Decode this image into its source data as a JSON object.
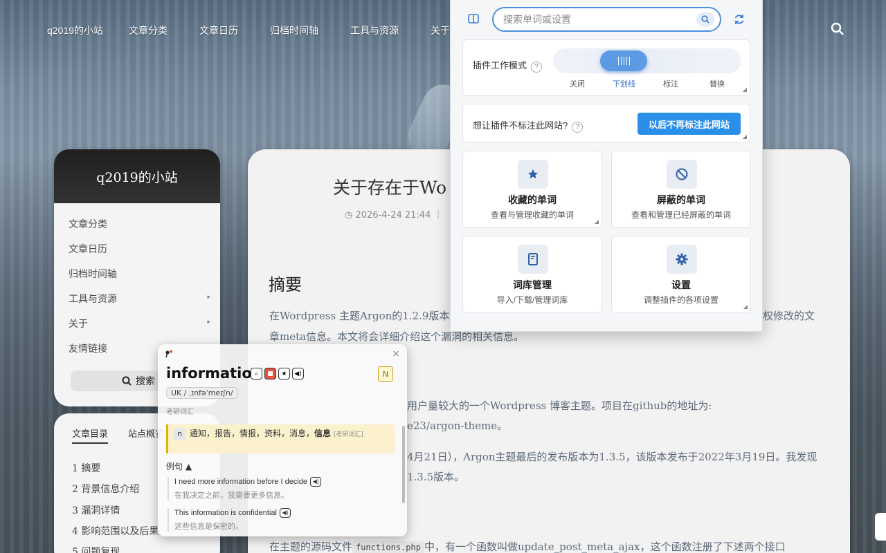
{
  "nav": {
    "brand": "q2019的小站",
    "items": [
      "文章分类",
      "文章日历",
      "归档时间轴",
      "工具与资源",
      "关于"
    ]
  },
  "sidebar": {
    "title": "q2019的小站",
    "items": [
      {
        "label": "文章分类"
      },
      {
        "label": "文章日历"
      },
      {
        "label": "归档时间轴"
      },
      {
        "label": "工具与资源",
        "caret": "▸"
      },
      {
        "label": "关于",
        "caret": "▸"
      },
      {
        "label": "友情链接"
      }
    ],
    "search_label": "搜索"
  },
  "toc": {
    "tabs": [
      "文章目录",
      "站点概览"
    ],
    "items": [
      "1 摘要",
      "2 背景信息介绍",
      "3 漏洞详情",
      "4 影响范围以及后果",
      "5 问题复现"
    ]
  },
  "article": {
    "title_visible": "关于存在于Wo",
    "meta_date": "2026-4-24 21:44",
    "heading": "摘要",
    "p1_a": "在Wordpress 主题Argon的1.2.9版本",
    "p1_b": "权修改的文",
    "p1_c": "章meta信息。本文将会详细介绍这个漏洞的相关信息。",
    "p2_a": "用户量较大的一个Wordpress 博客主题。项目在github的地址为:",
    "p2_b": "e23/argon-theme。",
    "p3_a": "4月21日），Argon主题最后的发布版本为1.3.5，该版本发布于2022年3月19日。我发现",
    "p3_b": "1.3.5版本。",
    "p4_a": "在主题的源码文件",
    "p4_code": "functions.php",
    "p4_b": "中，有一个函数叫做update_post_meta_ajax，这个函数注册了下述两个接口"
  },
  "plugin": {
    "search_placeholder": "搜索单词或设置",
    "mode_label": "插件工作模式",
    "mode_help": "?",
    "mode_options": [
      "关闭",
      "下划线",
      "标注",
      "替换"
    ],
    "mode_selected": "下划线",
    "site_label": "想让插件不标注此网站?",
    "site_button": "以后不再标注此网站",
    "tiles": [
      {
        "title": "收藏的单词",
        "sub": "查看与管理收藏的单词",
        "icon": "star-icon"
      },
      {
        "title": "屏蔽的单词",
        "sub": "查看和管理已经屏蔽的单词",
        "icon": "ban-icon"
      },
      {
        "title": "词库管理",
        "sub": "导入/下载/管理词库",
        "icon": "book-icon"
      },
      {
        "title": "设置",
        "sub": "调整插件的各项设置",
        "icon": "gear-icon"
      }
    ],
    "accent": "#2a8fe8"
  },
  "dict": {
    "word": "information",
    "badge": "N",
    "phonetic": "UK / ˌɪnfəˈmeɪʃn/",
    "tag": "考研词汇",
    "pos": "n",
    "definition_a": "通知，报告，情报，资料，消息，",
    "definition_bold": "信息",
    "definition_tag": "[考研词汇]",
    "examples_title": "例句",
    "examples": [
      {
        "en": "I need more information before I decide",
        "zh": "在我决定之前，我需要更多信息。"
      },
      {
        "en": "This information is confidential",
        "zh": "这些信息是保密的。"
      }
    ],
    "close": "×"
  }
}
